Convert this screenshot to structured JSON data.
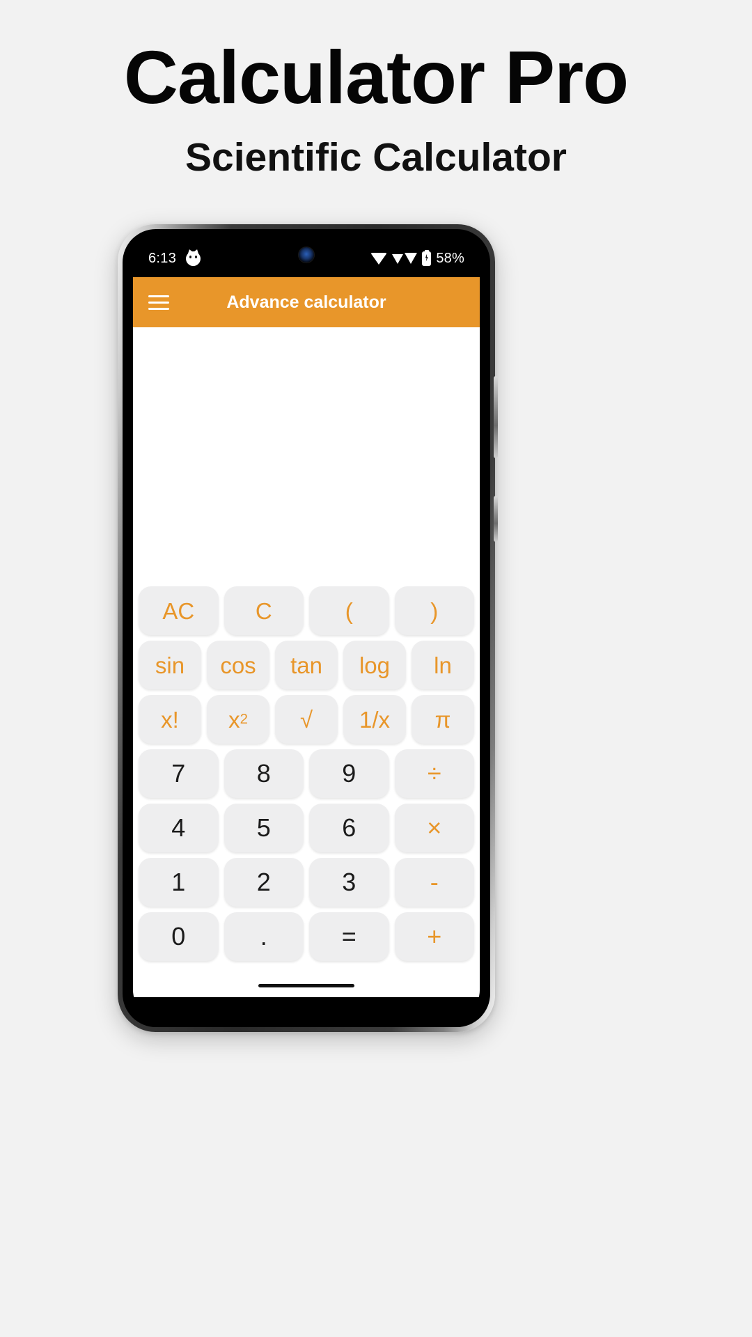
{
  "promo": {
    "title": "Calculator Pro",
    "subtitle": "Scientific Calculator"
  },
  "phone": {
    "status_bar": {
      "time": "6:13",
      "app_icon": "cat-face-icon",
      "wifi_icon": "wifi-icon",
      "signal_icon": "cellular-signal-icon",
      "battery_icon": "battery-charging-icon",
      "battery_percent": "58%"
    },
    "app_bar": {
      "menu_icon": "hamburger-menu-icon",
      "title": "Advance calculator"
    },
    "calculator": {
      "display": {
        "expression": "",
        "result": ""
      },
      "keys": [
        [
          {
            "label": "AC",
            "name": "key-all-clear",
            "type": "fn"
          },
          {
            "label": "C",
            "name": "key-clear",
            "type": "fn"
          },
          {
            "label": "(",
            "name": "key-open-paren",
            "type": "fn"
          },
          {
            "label": ")",
            "name": "key-close-paren",
            "type": "fn"
          }
        ],
        [
          {
            "label": "sin",
            "name": "key-sin",
            "type": "fn"
          },
          {
            "label": "cos",
            "name": "key-cos",
            "type": "fn"
          },
          {
            "label": "tan",
            "name": "key-tan",
            "type": "fn"
          },
          {
            "label": "log",
            "name": "key-log",
            "type": "fn"
          },
          {
            "label": "ln",
            "name": "key-ln",
            "type": "fn"
          }
        ],
        [
          {
            "label": "x!",
            "name": "key-factorial",
            "type": "fn"
          },
          {
            "label": "x2",
            "name": "key-square",
            "type": "fn",
            "sup": "2",
            "base": "x"
          },
          {
            "label": "√",
            "name": "key-square-root",
            "type": "fn"
          },
          {
            "label": "1/x",
            "name": "key-reciprocal",
            "type": "fn"
          },
          {
            "label": "π",
            "name": "key-pi",
            "type": "fn"
          }
        ],
        [
          {
            "label": "7",
            "name": "key-7",
            "type": "num"
          },
          {
            "label": "8",
            "name": "key-8",
            "type": "num"
          },
          {
            "label": "9",
            "name": "key-9",
            "type": "num"
          },
          {
            "label": "÷",
            "name": "key-divide",
            "type": "op"
          }
        ],
        [
          {
            "label": "4",
            "name": "key-4",
            "type": "num"
          },
          {
            "label": "5",
            "name": "key-5",
            "type": "num"
          },
          {
            "label": "6",
            "name": "key-6",
            "type": "num"
          },
          {
            "label": "×",
            "name": "key-multiply",
            "type": "op"
          }
        ],
        [
          {
            "label": "1",
            "name": "key-1",
            "type": "num"
          },
          {
            "label": "2",
            "name": "key-2",
            "type": "num"
          },
          {
            "label": "3",
            "name": "key-3",
            "type": "num"
          },
          {
            "label": "-",
            "name": "key-subtract",
            "type": "op"
          }
        ],
        [
          {
            "label": "0",
            "name": "key-0",
            "type": "num"
          },
          {
            "label": ".",
            "name": "key-decimal-point",
            "type": "num"
          },
          {
            "label": "=",
            "name": "key-equals",
            "type": "num"
          },
          {
            "label": "+",
            "name": "key-add",
            "type": "op"
          }
        ]
      ]
    }
  },
  "colors": {
    "accent": "#e8962a",
    "page_bg": "#f2f2f2",
    "key_bg": "#eeeeef",
    "num_text": "#1b1b1b"
  }
}
